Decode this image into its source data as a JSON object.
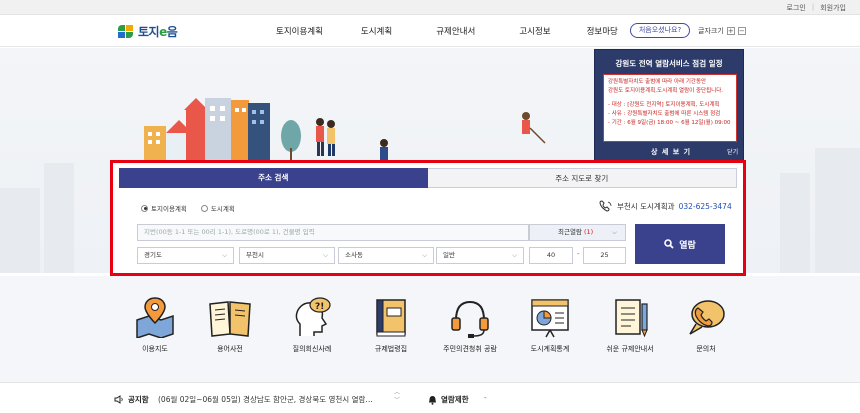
{
  "util": {
    "login": "로그인",
    "join": "회원가입"
  },
  "header": {
    "logo_main": "토지",
    "logo_e": "e",
    "logo_tail": "음",
    "nav": [
      "토지이용계획",
      "도시계획",
      "규제안내서",
      "고시정보",
      "정보마당"
    ],
    "first_visit": "처음오셨나요?",
    "font_size_label": "글자크기",
    "font_plus": "+",
    "font_minus": "−"
  },
  "popup": {
    "title": "강원도 전역 열람서비스 점검 일정",
    "lines": [
      "강원특별자치도 출범에 따라 아래 기간동안",
      "강원도 토지이용계획,도시계획 열람이 중단됩니다.",
      "- 대상 : [강원도 전지역] 토지이용계획, 도시계획",
      "- 사유 : 강원특별자치도 출범에 따른 시스템 점검",
      "- 기간 : 6월 9일(금) 18:00 ~ 6월 12일(월) 09:00"
    ],
    "detail": "상 세 보 기",
    "close": "닫기"
  },
  "search": {
    "tab_address": "주소 검색",
    "tab_map": "주소 지도로 찾기",
    "radio_land": "토지이용계획",
    "radio_city": "도시계획",
    "contact_label": "부천시 도시계획과",
    "contact_phone": "032-625-3474",
    "address_placeholder": "지번(00동 1-1 또는 00리 1-1), 도로명(00로 1), 건물명 입력",
    "recent_label": "최근열람",
    "recent_count": "(1)",
    "sido": "경기도",
    "sigungu": "부천시",
    "dong": "소사동",
    "type": "일반",
    "bonbun": "40",
    "dash": "-",
    "bubun": "25",
    "button": "열람"
  },
  "quick": [
    {
      "label": "이용지도",
      "icon": "map-pin-icon"
    },
    {
      "label": "용어사전",
      "icon": "book-icon"
    },
    {
      "label": "질의회신사례",
      "icon": "question-head-icon"
    },
    {
      "label": "규제법령집",
      "icon": "law-book-icon"
    },
    {
      "label": "주민의견청취 공람",
      "icon": "headset-icon"
    },
    {
      "label": "도시계획통계",
      "icon": "statistics-board-icon"
    },
    {
      "label": "쉬운 규제안내서",
      "icon": "guide-document-icon"
    },
    {
      "label": "문의처",
      "icon": "phone-bubble-icon"
    }
  ],
  "bottom": {
    "notice_label": "공지함",
    "notice_text": "(06월 02일~06월 05일) 경상남도 함안군, 경상북도 영천시 열람…",
    "restrict_label": "열람제한",
    "restrict_text": "-"
  }
}
